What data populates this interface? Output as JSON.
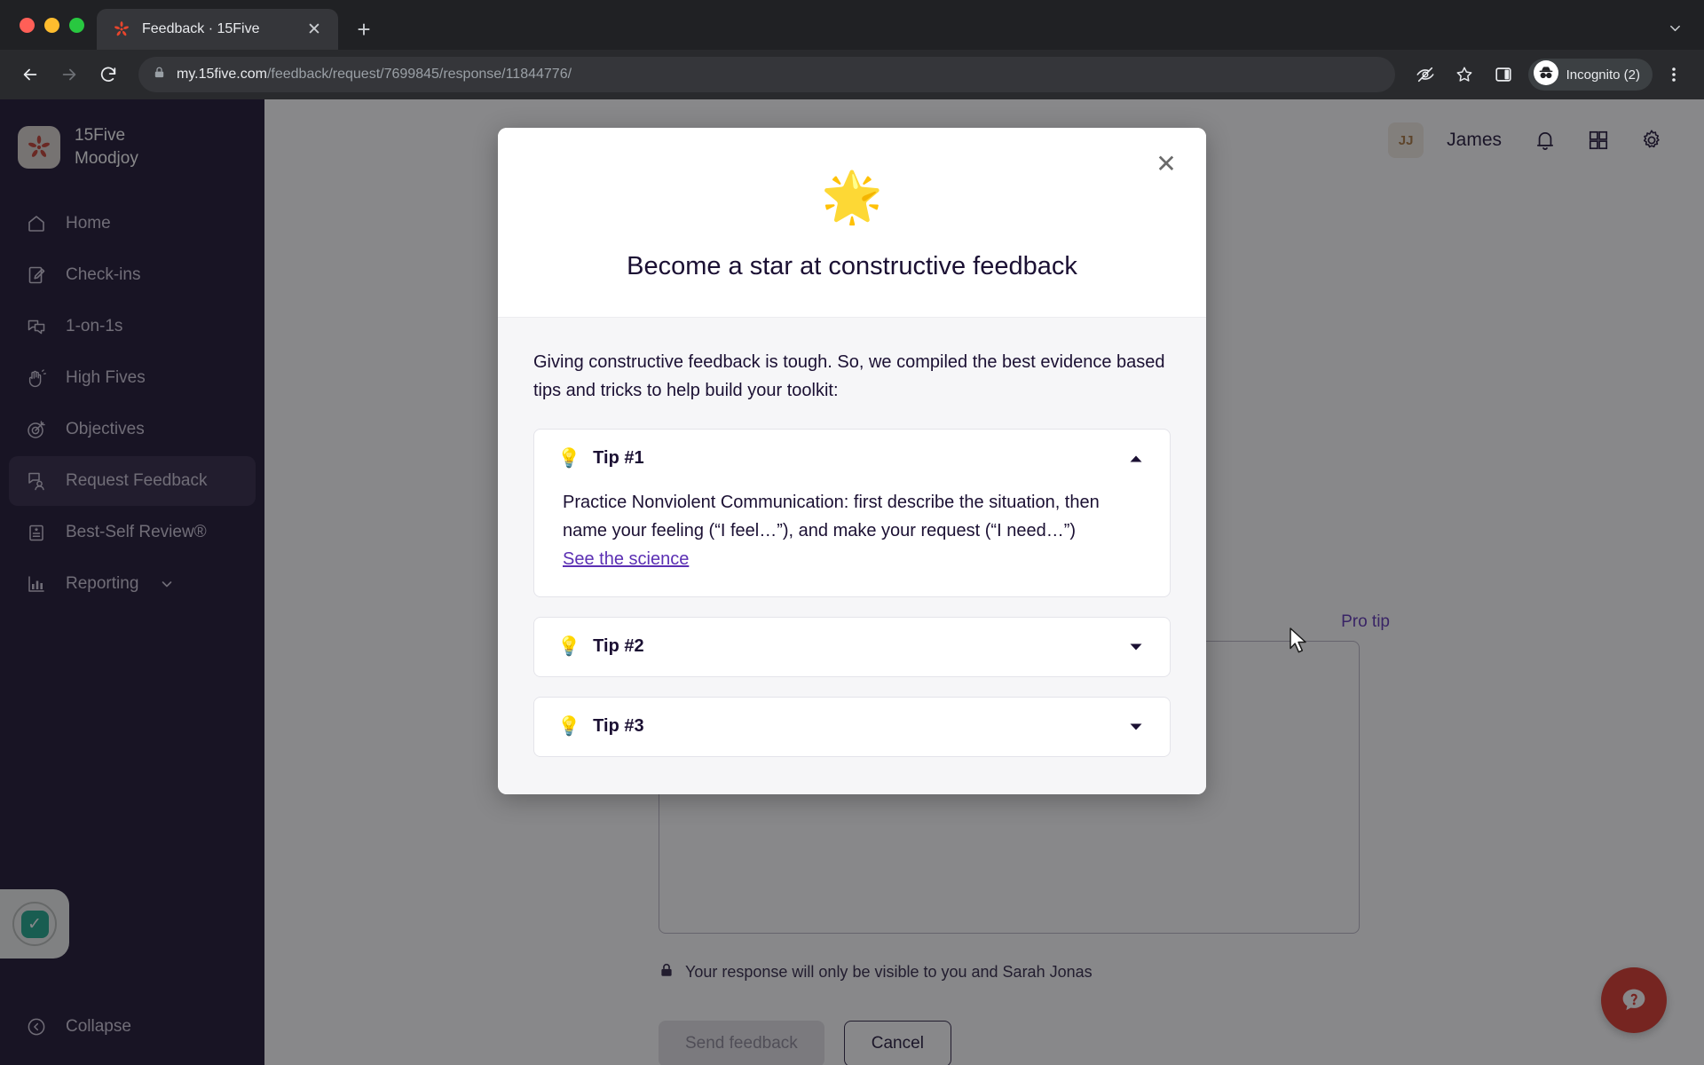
{
  "browser": {
    "tab": {
      "title": "Feedback · 15Five",
      "favicon": "15five-logo-icon",
      "close": "✕"
    },
    "new_tab": "+",
    "omnibox": {
      "domain": "my.15five.com",
      "path": "/feedback/request/7699845/response/11844776/",
      "lock": "lock-icon"
    },
    "profile": {
      "label": "Incognito (2)"
    },
    "actions": {
      "back": "back-arrow-icon",
      "forward": "forward-arrow-icon",
      "reload": "reload-icon",
      "tracking": "eye-slash-icon",
      "bookmark": "star-icon",
      "side_panel": "side-panel-icon",
      "menu": "three-dot-menu-icon",
      "tab_search": "chevron-down-icon"
    }
  },
  "sidebar": {
    "workspace": {
      "name": "15Five",
      "sub": "Moodjoy",
      "logo": "15five-logo-icon"
    },
    "items": [
      {
        "label": "Home",
        "icon": "home-icon",
        "active": false
      },
      {
        "label": "Check-ins",
        "icon": "checkins-icon",
        "active": false
      },
      {
        "label": "1-on-1s",
        "icon": "one-on-ones-icon",
        "active": false
      },
      {
        "label": "High Fives",
        "icon": "high-fives-icon",
        "active": false
      },
      {
        "label": "Objectives",
        "icon": "objectives-target-icon",
        "active": false
      },
      {
        "label": "Request Feedback",
        "icon": "request-feedback-icon",
        "active": true
      },
      {
        "label": "Best-Self Review®",
        "icon": "best-self-review-icon",
        "active": false
      },
      {
        "label": "Reporting",
        "icon": "reporting-bar-chart-icon",
        "active": false,
        "caret": true
      }
    ],
    "extension_badge": "checkmark-badge-icon",
    "collapse": {
      "label": "Collapse",
      "icon": "chevron-left-circle-icon"
    }
  },
  "topbar": {
    "avatar_initials": "JJ",
    "user_name": "James",
    "icons": [
      "bell-icon",
      "apps-grid-icon",
      "gear-icon"
    ]
  },
  "page": {
    "pro_tip_link": "Pro tip",
    "privacy_note": "Your response will only be visible to you and Sarah Jonas",
    "privacy_icon": "lock-icon",
    "send_button": "Send feedback",
    "cancel_button": "Cancel",
    "help_button": "help-question-icon"
  },
  "modal": {
    "close": "✕",
    "emoji": "🌟",
    "title": "Become a star at constructive feedback",
    "intro": "Giving constructive feedback is tough. So, we compiled the best evidence based tips and tricks to help build your toolkit:",
    "tips": [
      {
        "label": "Tip #1",
        "bulb": "💡",
        "expanded": true,
        "caret": "caret-up-icon",
        "body": "Practice Nonviolent Communication: first describe the situation, then name your feeling (“I feel…”), and make your request (“I need…”)",
        "link": "See the science"
      },
      {
        "label": "Tip #2",
        "bulb": "💡",
        "expanded": false,
        "caret": "caret-down-icon"
      },
      {
        "label": "Tip #3",
        "bulb": "💡",
        "expanded": false,
        "caret": "caret-down-icon"
      }
    ]
  },
  "colors": {
    "sidebar_bg": "#150d2b",
    "sidebar_active": "#2a2140",
    "brand_purple": "#5b2fb3",
    "brand_red": "#d93025",
    "text_dark": "#1b1033",
    "modal_body_bg": "#f6f6f8"
  }
}
